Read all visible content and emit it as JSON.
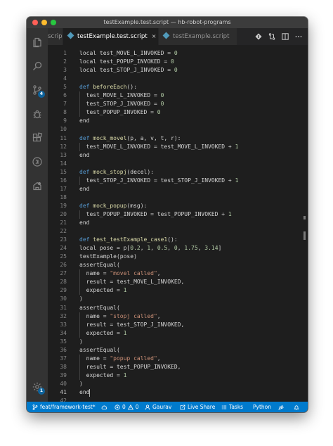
{
  "window": {
    "title": "testExample.test.script — hb-robot-programs"
  },
  "tabs": {
    "truncated_label": "script",
    "active_label": "testExample.test.script",
    "inactive_label": "testExample.script",
    "close_glyph": "×"
  },
  "activity_bar": {
    "icons": [
      "files-icon",
      "search-icon",
      "source-control-icon",
      "debug-icon",
      "extensions-icon",
      "remote-explorer-icon",
      "robot-extension-icon"
    ],
    "source_control_badge": "4",
    "settings_badge": "1"
  },
  "editor": {
    "active_line": 41,
    "lines": [
      [
        [
          "",
          "local test_MOVE_L_INVOKED = "
        ],
        [
          "num",
          "0"
        ]
      ],
      [
        [
          "",
          "local test_POPUP_INVOKED = "
        ],
        [
          "num",
          "0"
        ]
      ],
      [
        [
          "",
          "local test_STOP_J_INVOKED = "
        ],
        [
          "num",
          "0"
        ]
      ],
      [],
      [
        [
          "kw",
          "def "
        ],
        [
          "fn",
          "beforeEach"
        ],
        [
          "",
          "():"
        ]
      ],
      [
        [
          "",
          "  test_MOVE_L_INVOKED = "
        ],
        [
          "num",
          "0"
        ]
      ],
      [
        [
          "",
          "  test_STOP_J_INVOKED = "
        ],
        [
          "num",
          "0"
        ]
      ],
      [
        [
          "",
          "  test_POPUP_INVOKED = "
        ],
        [
          "num",
          "0"
        ]
      ],
      [
        [
          "",
          "end"
        ]
      ],
      [],
      [
        [
          "kw",
          "def "
        ],
        [
          "fn",
          "mock_movel"
        ],
        [
          "",
          "(p, a, v, t, r):"
        ]
      ],
      [
        [
          "",
          "  test_MOVE_L_INVOKED = test_MOVE_L_INVOKED + "
        ],
        [
          "num",
          "1"
        ]
      ],
      [
        [
          "",
          "end"
        ]
      ],
      [],
      [
        [
          "kw",
          "def "
        ],
        [
          "fn",
          "mock_stopj"
        ],
        [
          "",
          "(decel):"
        ]
      ],
      [
        [
          "",
          "  test_STOP_J_INVOKED = test_STOP_J_INVOKED + "
        ],
        [
          "num",
          "1"
        ]
      ],
      [
        [
          "",
          "end"
        ]
      ],
      [],
      [
        [
          "kw",
          "def "
        ],
        [
          "fn",
          "mock_popup"
        ],
        [
          "",
          "(msg):"
        ]
      ],
      [
        [
          "",
          "  test_POPUP_INVOKED = test_POPUP_INVOKED + "
        ],
        [
          "num",
          "1"
        ]
      ],
      [
        [
          "",
          "end"
        ]
      ],
      [],
      [
        [
          "kw",
          "def "
        ],
        [
          "fn",
          "test_testExample_case1"
        ],
        [
          "",
          "():"
        ]
      ],
      [
        [
          "",
          "local pose = p["
        ],
        [
          "num",
          "0.2"
        ],
        [
          "",
          ", "
        ],
        [
          "num",
          "1"
        ],
        [
          "",
          ", "
        ],
        [
          "num",
          "0.5"
        ],
        [
          "",
          ", "
        ],
        [
          "num",
          "0"
        ],
        [
          "",
          ", "
        ],
        [
          "num",
          "1.75"
        ],
        [
          "",
          ", "
        ],
        [
          "num",
          "3.14"
        ],
        [
          "",
          "]"
        ]
      ],
      [
        [
          "",
          "testExample(pose)"
        ]
      ],
      [
        [
          "",
          "assertEqual("
        ]
      ],
      [
        [
          "",
          "  name = "
        ],
        [
          "str",
          "\"movel called\""
        ],
        [
          "",
          ","
        ]
      ],
      [
        [
          "",
          "  result = test_MOVE_L_INVOKED,"
        ]
      ],
      [
        [
          "",
          "  expected = "
        ],
        [
          "num",
          "1"
        ]
      ],
      [
        [
          "",
          ")"
        ]
      ],
      [
        [
          "",
          "assertEqual("
        ]
      ],
      [
        [
          "",
          "  name = "
        ],
        [
          "str",
          "\"stopj called\""
        ],
        [
          "",
          ","
        ]
      ],
      [
        [
          "",
          "  result = test_STOP_J_INVOKED,"
        ]
      ],
      [
        [
          "",
          "  expected = "
        ],
        [
          "num",
          "1"
        ]
      ],
      [
        [
          "",
          ")"
        ]
      ],
      [
        [
          "",
          "assertEqual("
        ]
      ],
      [
        [
          "",
          "  name = "
        ],
        [
          "str",
          "\"popup called\""
        ],
        [
          "",
          ","
        ]
      ],
      [
        [
          "",
          "  result = test_POPUP_INVOKED,"
        ]
      ],
      [
        [
          "",
          "  expected = "
        ],
        [
          "num",
          "1"
        ]
      ],
      [
        [
          "",
          ")"
        ]
      ],
      [
        [
          "",
          "end"
        ]
      ]
    ]
  },
  "statusbar": {
    "branch": "feat/framework-test*",
    "errors": "0",
    "warnings": "0",
    "user": "Gaurav",
    "live_share": "Live Share",
    "tasks": "Tasks",
    "language": "Python"
  },
  "colors": {
    "accent": "#007acc",
    "keyword": "#569cd6",
    "function": "#dcdcaa",
    "string": "#ce9178",
    "number": "#b5cea8"
  }
}
